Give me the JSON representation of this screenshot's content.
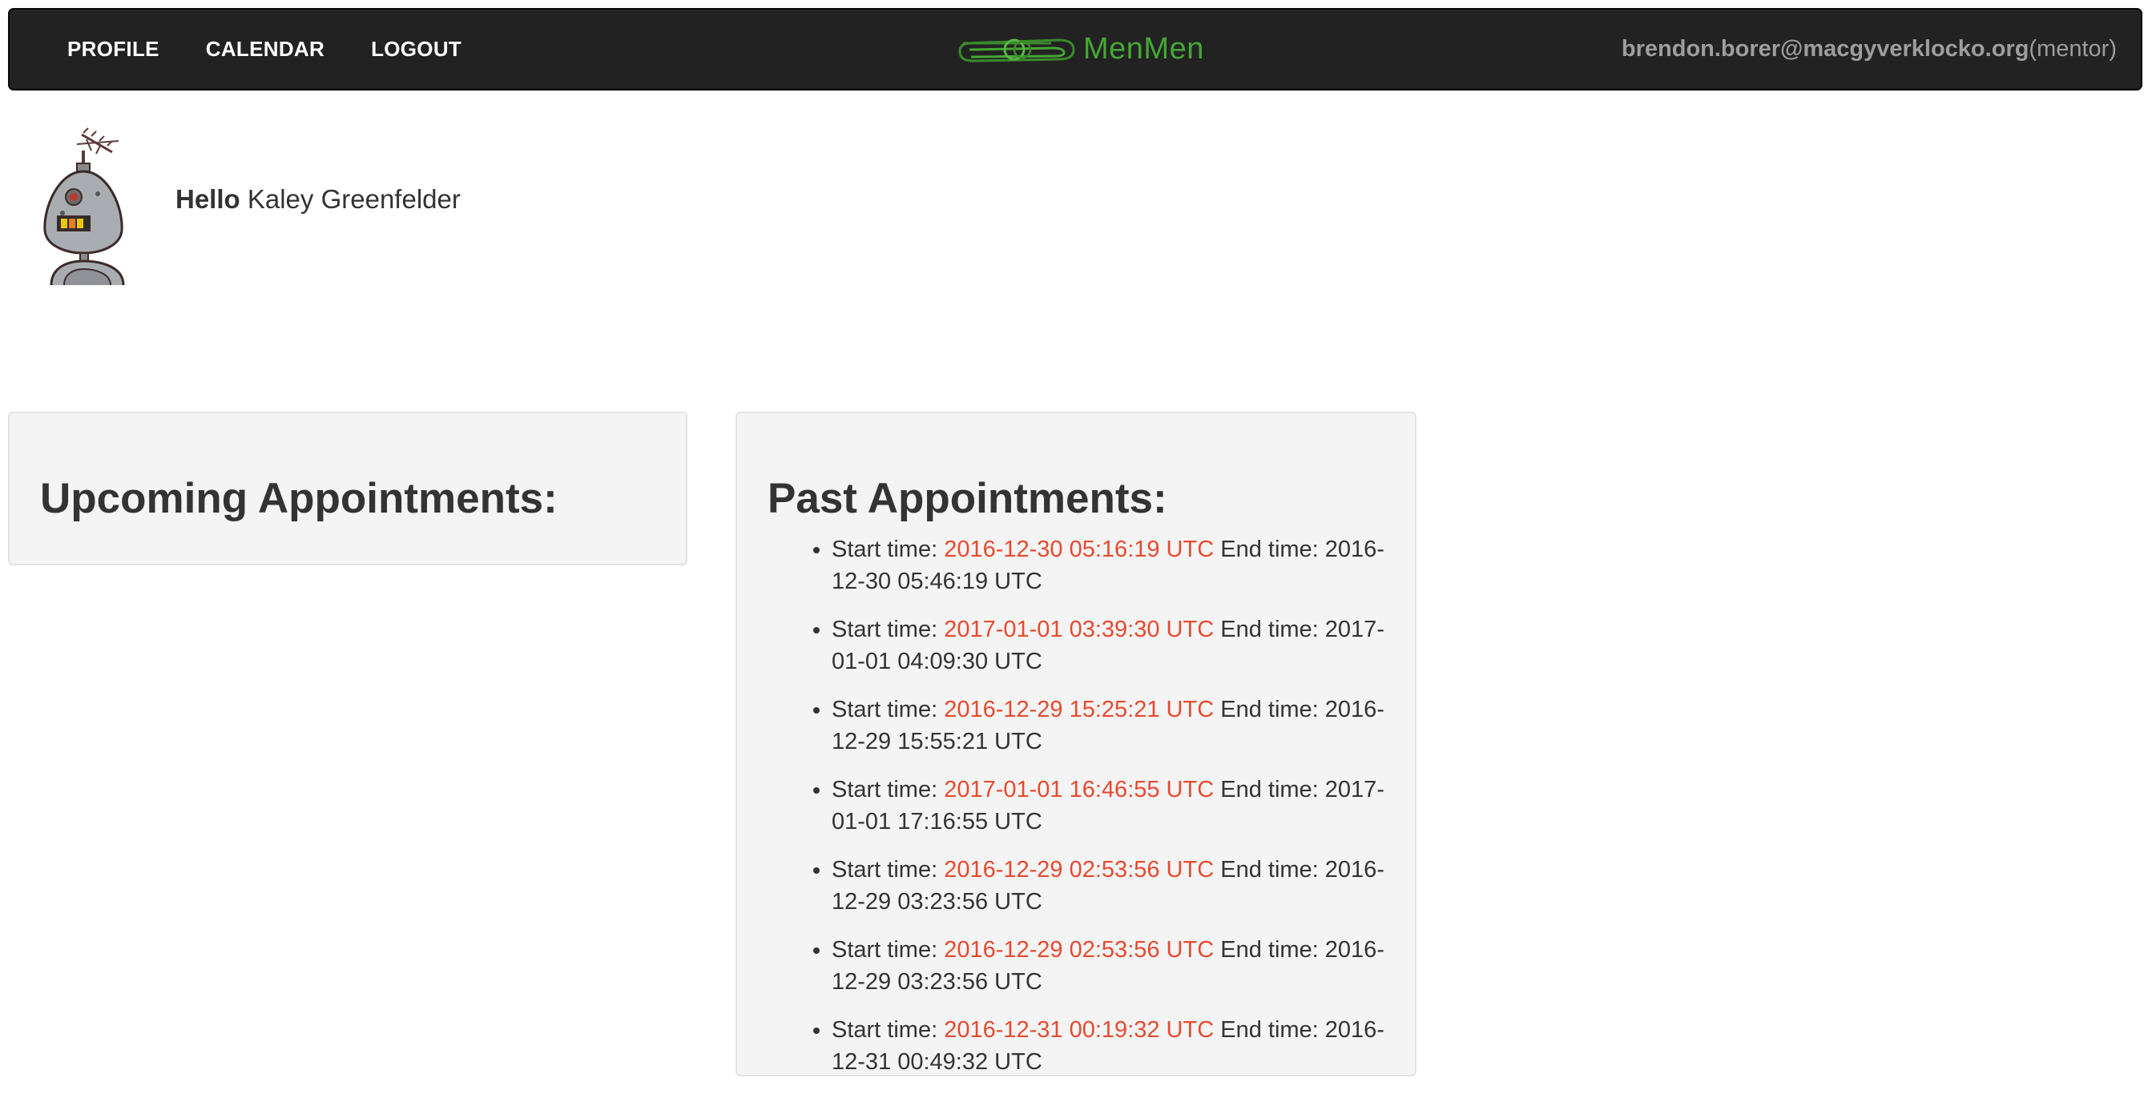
{
  "nav": {
    "links": [
      "PROFILE",
      "CALENDAR",
      "LOGOUT"
    ],
    "brand": "MenMen",
    "user_email": "brendon.borer@macgyverklocko.org",
    "user_role": "(mentor)"
  },
  "profile": {
    "hello_label": "Hello",
    "name": "Kaley Greenfelder"
  },
  "upcoming": {
    "title": "Upcoming Appointments:"
  },
  "past": {
    "title": "Past Appointments:",
    "start_label": "Start time:",
    "end_label": "End time:",
    "items": [
      {
        "start": "2016-12-30 05:16:19 UTC",
        "end": "2016-12-30 05:46:19 UTC"
      },
      {
        "start": "2017-01-01 03:39:30 UTC",
        "end": "2017-01-01 04:09:30 UTC"
      },
      {
        "start": "2016-12-29 15:25:21 UTC",
        "end": "2016-12-29 15:55:21 UTC"
      },
      {
        "start": "2017-01-01 16:46:55 UTC",
        "end": "2017-01-01 17:16:55 UTC"
      },
      {
        "start": "2016-12-29 02:53:56 UTC",
        "end": "2016-12-29 03:23:56 UTC"
      },
      {
        "start": "2016-12-29 02:53:56 UTC",
        "end": "2016-12-29 03:23:56 UTC"
      },
      {
        "start": "2016-12-31 00:19:32 UTC",
        "end": "2016-12-31 00:49:32 UTC"
      }
    ]
  },
  "colors": {
    "navbar_bg": "#222222",
    "brand_green": "#45a833",
    "link_accent": "#e84a2e",
    "panel_bg": "#f4f4f4"
  },
  "icons": {
    "logo": "paperclip-logo-icon",
    "avatar": "robot-avatar-icon"
  }
}
